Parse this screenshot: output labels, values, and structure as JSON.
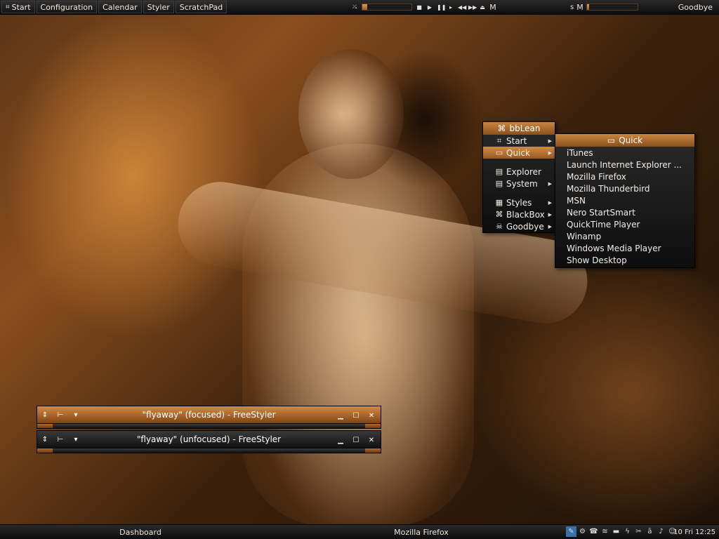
{
  "top_bar": {
    "buttons": [
      {
        "label": "Start",
        "icon": "blackbox-icon"
      },
      {
        "label": "Configuration"
      },
      {
        "label": "Calendar"
      },
      {
        "label": "Styler"
      },
      {
        "label": "ScratchPad"
      }
    ],
    "media": {
      "mode_label": "M",
      "progress_fraction": 0.1
    },
    "volume": {
      "label_s": "s",
      "label_m": "M",
      "level_fraction": 0.05
    },
    "goodbye_label": "Goodbye"
  },
  "root_menu": {
    "title": "bbLean",
    "items": [
      {
        "label": "Start",
        "icon": "blackbox-icon",
        "submenu": true
      },
      {
        "label": "Quick",
        "icon": "folder-icon",
        "submenu": true,
        "active": true
      },
      {
        "label": "Explorer",
        "icon": "computer-icon",
        "submenu": false
      },
      {
        "label": "System",
        "icon": "computer-icon",
        "submenu": true
      },
      {
        "label": "Styles",
        "icon": "palette-icon",
        "submenu": true
      },
      {
        "label": "BlackBox",
        "icon": "blackbox-icon",
        "submenu": true
      },
      {
        "label": "Goodbye",
        "icon": "exit-icon",
        "submenu": true
      }
    ]
  },
  "quick_menu": {
    "title": "Quick",
    "items": [
      "iTunes",
      "Launch Internet Explorer ...",
      "Mozilla Firefox",
      "Mozilla Thunderbird",
      "MSN",
      "Nero StartSmart",
      "QuickTime Player",
      "Winamp",
      "Windows Media Player",
      "Show Desktop"
    ]
  },
  "windows": [
    {
      "title": "\"flyaway\" (focused) - FreeStyler",
      "focused": true
    },
    {
      "title": "\"flyaway\" (unfocused) - FreeStyler",
      "focused": false
    }
  ],
  "bottom_bar": {
    "tasks": [
      "Dashboard",
      "Mozilla Firefox"
    ],
    "clock": "10 Fri 12:25"
  },
  "colors": {
    "accent": "#c07a38",
    "bar_dark": "#111111"
  }
}
